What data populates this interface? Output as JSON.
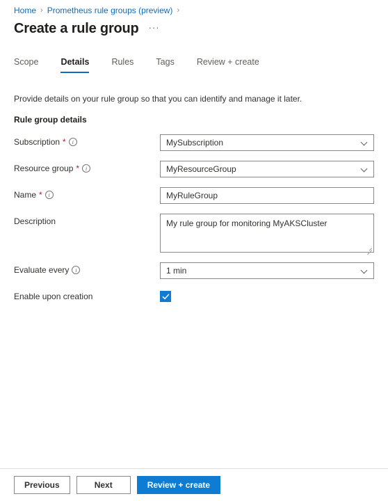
{
  "breadcrumb": {
    "items": [
      {
        "label": "Home"
      },
      {
        "label": "Prometheus rule groups (preview)"
      }
    ],
    "separator": "›"
  },
  "header": {
    "title": "Create a rule group",
    "more_menu": "···"
  },
  "tabs": [
    {
      "label": "Scope",
      "active": false
    },
    {
      "label": "Details",
      "active": true
    },
    {
      "label": "Rules",
      "active": false
    },
    {
      "label": "Tags",
      "active": false
    },
    {
      "label": "Review + create",
      "active": false
    }
  ],
  "main": {
    "intro": "Provide details on your rule group so that you can identify and manage it later.",
    "section_heading": "Rule group details",
    "fields": {
      "subscription": {
        "label": "Subscription",
        "required_marker": "*",
        "info_glyph": "i",
        "value": "MySubscription"
      },
      "resource_group": {
        "label": "Resource group",
        "required_marker": "*",
        "info_glyph": "i",
        "value": "MyResourceGroup"
      },
      "name": {
        "label": "Name",
        "required_marker": "*",
        "info_glyph": "i",
        "value": "MyRuleGroup",
        "placeholder": ""
      },
      "description": {
        "label": "Description",
        "value": "My rule group for monitoring MyAKSCluster",
        "placeholder": ""
      },
      "evaluate_every": {
        "label": "Evaluate every",
        "info_glyph": "i",
        "value": "1 min"
      },
      "enable_upon_creation": {
        "label": "Enable upon creation",
        "checked": true
      }
    }
  },
  "footer": {
    "previous_label": "Previous",
    "next_label": "Next",
    "review_create_label": "Review + create"
  },
  "colors": {
    "accent": "#0f6cbd",
    "primary_button": "#0f7cd4",
    "link": "#0f6cbd",
    "required": "#a4262c",
    "border": "#8a8886",
    "text": "#323130"
  }
}
